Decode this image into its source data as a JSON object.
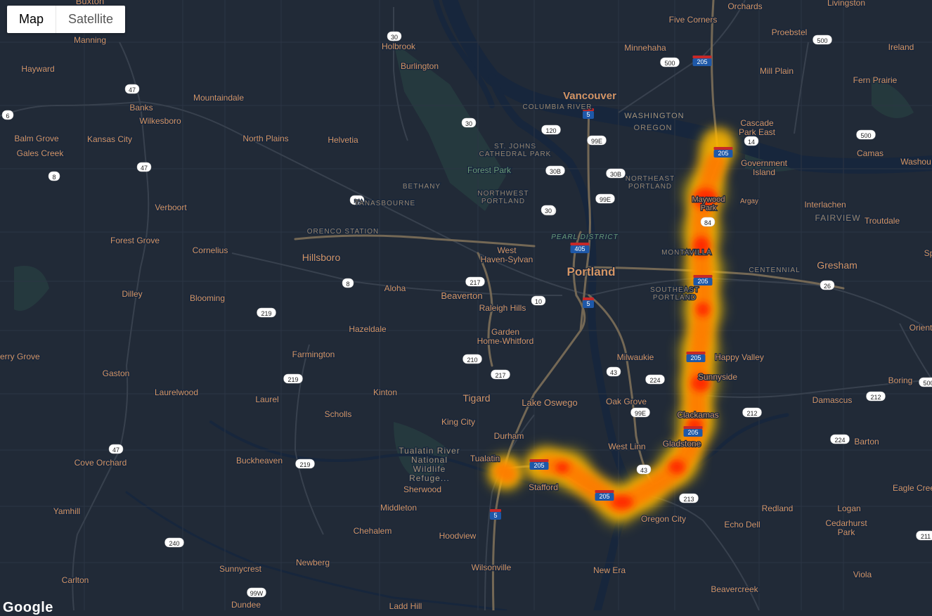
{
  "map_type": {
    "options": [
      "Map",
      "Satellite"
    ],
    "selected": "Map"
  },
  "watermark": "Google",
  "colors": {
    "land": "#212a37",
    "water": "#17263c",
    "park": "#263c3f",
    "road": "#38414e",
    "highway": "#746855",
    "label": "#d59563",
    "heat_low": "#ffd600",
    "heat_mid": "#ff8a00",
    "heat_high": "#ff1a00"
  },
  "places": [
    {
      "n": "Buxton"
    },
    {
      "n": "Manning"
    },
    {
      "n": "Hayward"
    },
    {
      "n": "Banks"
    },
    {
      "n": "Wilkesboro"
    },
    {
      "n": "Mountaindale"
    },
    {
      "n": "Balm Grove"
    },
    {
      "n": "Gales Creek"
    },
    {
      "n": "Kansas City"
    },
    {
      "n": "North Plains"
    },
    {
      "n": "Helvetia"
    },
    {
      "n": "Verboort"
    },
    {
      "n": "Forest Grove"
    },
    {
      "n": "Cornelius"
    },
    {
      "n": "Hillsboro"
    },
    {
      "n": "Dilley"
    },
    {
      "n": "Blooming"
    },
    {
      "n": "Aloha"
    },
    {
      "n": "Beaverton"
    },
    {
      "n": "Raleigh Hills"
    },
    {
      "n": "Hazeldale"
    },
    {
      "n": "Farmington"
    },
    {
      "n": "erry Grove"
    },
    {
      "n": "Gaston"
    },
    {
      "n": "Laurelwood"
    },
    {
      "n": "Laurel"
    },
    {
      "n": "Scholls"
    },
    {
      "n": "Kinton"
    },
    {
      "n": "Tigard"
    },
    {
      "n": "King City"
    },
    {
      "n": "Durham"
    },
    {
      "n": "Tualatin"
    },
    {
      "n": "Cove Orchard"
    },
    {
      "n": "Buckheaven"
    },
    {
      "n": "Sherwood"
    },
    {
      "n": "Middleton"
    },
    {
      "n": "Chehalem"
    },
    {
      "n": "Yamhill"
    },
    {
      "n": "Sunnycrest"
    },
    {
      "n": "Newberg"
    },
    {
      "n": "Carlton"
    },
    {
      "n": "Dundee"
    },
    {
      "n": "Ladd Hill"
    },
    {
      "n": "Hoodview"
    },
    {
      "n": "Wilsonville"
    },
    {
      "n": "Stafford"
    },
    {
      "n": "Holbrook"
    },
    {
      "n": "Burlington"
    },
    {
      "n": "Forest Park"
    },
    {
      "n": "Vancouver"
    },
    {
      "n": "Portland"
    },
    {
      "n": "West Haven-Sylvan"
    },
    {
      "n": "Garden Home-Whitford"
    },
    {
      "n": "Lake Oswego"
    },
    {
      "n": "Milwaukie"
    },
    {
      "n": "Oak Grove"
    },
    {
      "n": "West Linn"
    },
    {
      "n": "Gladstone"
    },
    {
      "n": "Oregon City"
    },
    {
      "n": "New Era"
    },
    {
      "n": "Happy Valley"
    },
    {
      "n": "Sunnyside"
    },
    {
      "n": "Clackamas"
    },
    {
      "n": "Damascus"
    },
    {
      "n": "Boring"
    },
    {
      "n": "Barton"
    },
    {
      "n": "Redland"
    },
    {
      "n": "Logan"
    },
    {
      "n": "Echo Dell"
    },
    {
      "n": "Cedarhurst Park"
    },
    {
      "n": "Beavercreek"
    },
    {
      "n": "Viola"
    },
    {
      "n": "Eagle Cree"
    },
    {
      "n": "Gresham"
    },
    {
      "n": "Orient"
    },
    {
      "n": "Five Corners"
    },
    {
      "n": "Minnehaha"
    },
    {
      "n": "Orchards"
    },
    {
      "n": "Livingston"
    },
    {
      "n": "Proebstel"
    },
    {
      "n": "Ireland"
    },
    {
      "n": "Mill Plain"
    },
    {
      "n": "Fern Prairie"
    },
    {
      "n": "Cascade Park East"
    },
    {
      "n": "Camas"
    },
    {
      "n": "Washou"
    },
    {
      "n": "Government Island"
    },
    {
      "n": "Maywood Park"
    },
    {
      "n": "Argay"
    },
    {
      "n": "Interlachen"
    },
    {
      "n": "Fairview"
    },
    {
      "n": "Troutdale"
    },
    {
      "n": "Centennial"
    },
    {
      "n": "Montavilla"
    },
    {
      "n": "Southeast Portland"
    },
    {
      "n": "Northeast Portland"
    },
    {
      "n": "Northwest Portland"
    },
    {
      "n": "St. Johns Cathedral Park"
    },
    {
      "n": "Bethany"
    },
    {
      "n": "Orenco Station"
    },
    {
      "n": "Tanasbourne"
    },
    {
      "n": "Pearl District"
    },
    {
      "n": "Tualatin River National Wildlife Refuge"
    },
    {
      "n": "WASHINGTON"
    },
    {
      "n": "OREGON"
    },
    {
      "n": "Columbia River"
    },
    {
      "n": "Sp"
    }
  ],
  "shields": [
    "30",
    "47",
    "6",
    "47",
    "8",
    "26",
    "8",
    "219",
    "219",
    "219",
    "47",
    "240",
    "99W",
    "30",
    "30",
    "120",
    "99E",
    "30B",
    "30B",
    "99E",
    "30",
    "405",
    "217",
    "10",
    "5",
    "210",
    "217",
    "43",
    "224",
    "99E",
    "43",
    "213",
    "5",
    "212",
    "224",
    "212",
    "211",
    "500",
    "500",
    "500",
    "500",
    "26",
    "205",
    "205",
    "205",
    "205",
    "205",
    "205",
    "14",
    "205",
    "84",
    "5"
  ],
  "heatmap": {
    "route": "I-205 corridor (Vancouver to Tualatin)",
    "intensity_points": [
      {
        "id": "h1",
        "w": 0.7
      },
      {
        "id": "h2",
        "w": 1.0
      },
      {
        "id": "h3",
        "w": 0.95
      },
      {
        "id": "h4",
        "w": 0.9
      },
      {
        "id": "h5",
        "w": 0.8
      },
      {
        "id": "h6",
        "w": 0.8
      },
      {
        "id": "h7",
        "w": 0.85
      },
      {
        "id": "h8",
        "w": 0.9
      },
      {
        "id": "h9",
        "w": 0.9
      },
      {
        "id": "h10",
        "w": 0.85
      },
      {
        "id": "h11",
        "w": 0.8
      },
      {
        "id": "h12",
        "w": 0.9
      },
      {
        "id": "h13",
        "w": 0.8
      },
      {
        "id": "h14",
        "w": 0.85
      },
      {
        "id": "h15",
        "w": 0.7
      }
    ]
  }
}
